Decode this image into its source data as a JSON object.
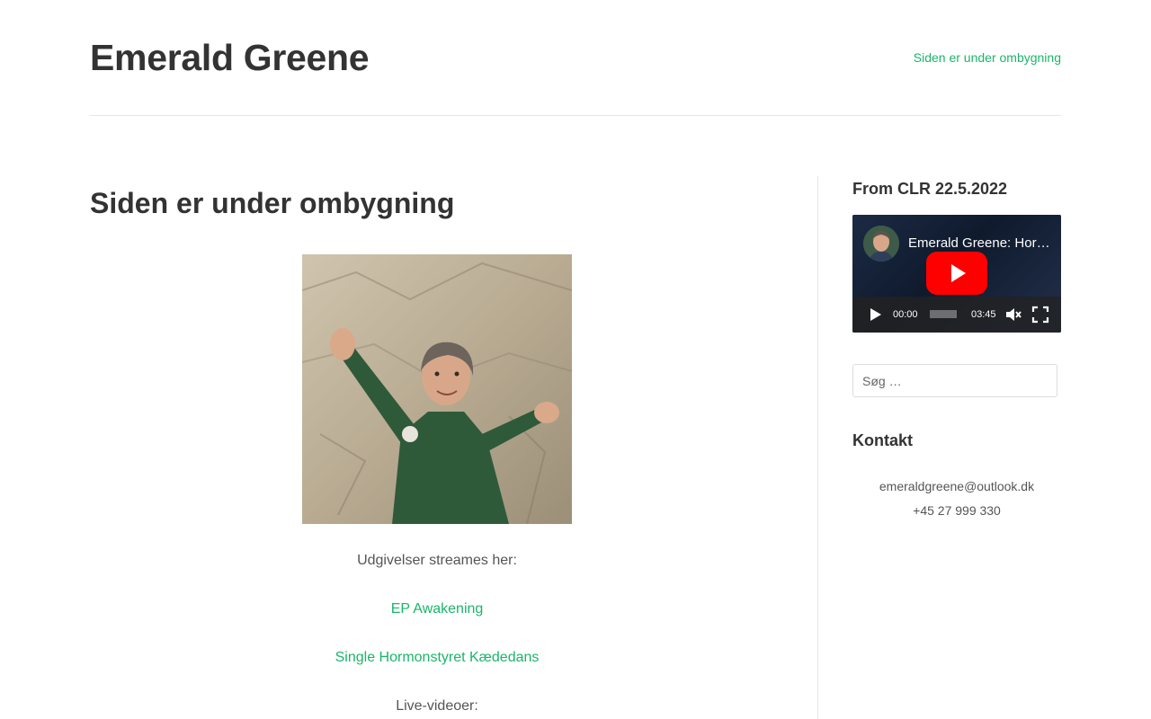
{
  "header": {
    "site_title": "Emerald Greene",
    "nav_link": "Siden er under ombygning"
  },
  "main": {
    "page_title": "Siden er under ombygning",
    "photo": {
      "description_icon": "portrait-photo"
    },
    "paragraphs": [
      {
        "text": "Udgivelser streames her:",
        "kind": "text"
      },
      {
        "text": "EP Awakening",
        "kind": "link"
      },
      {
        "text": "Single Hormonstyret Kædedans",
        "kind": "link"
      },
      {
        "text": "Live-videoer:",
        "kind": "text"
      }
    ]
  },
  "sidebar": {
    "video_widget": {
      "title": "From CLR 22.5.2022",
      "video_title": "Emerald Greene: Hormonstyret Kædedans",
      "current_time": "00:00",
      "duration": "03:45"
    },
    "search": {
      "placeholder": "Søg …"
    },
    "contact": {
      "title": "Kontakt",
      "email": "emeraldgreene@outlook.dk",
      "phone": "+45 27 999 330"
    }
  },
  "colors": {
    "accent": "#1ab56a",
    "text": "#333333",
    "divider": "#e6e6e6",
    "youtube_red": "#ff0000"
  }
}
